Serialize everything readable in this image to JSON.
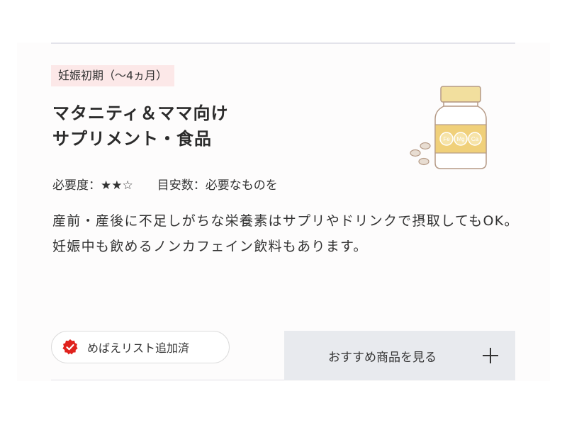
{
  "card": {
    "tag": "妊娠初期（〜4ヵ月）",
    "title_line1": "マタニティ＆ママ向け",
    "title_line2": "サプリメント・食品",
    "necessity_label": "必要度：",
    "necessity_rating": "★★☆",
    "guideline": "目安数：必要なものを",
    "description": "産前・産後に不足しがちな栄養素はサプリやドリンクで摂取してもOK。妊娠中も飲めるノンカフェイン飲料もあります。",
    "bottle_labels": [
      "Fe",
      "Mg",
      "Ca"
    ]
  },
  "actions": {
    "added_label": "めばえリスト追加済",
    "recommend_label": "おすすめ商品を見る"
  },
  "colors": {
    "tag_bg": "#fce8e8",
    "badge_red": "#e0221d",
    "button_bg": "#e8eaee",
    "bottle_cap": "#f2df9e",
    "bottle_label": "#f0d07a"
  },
  "icons": {
    "badge": "check-badge-icon",
    "plus": "plus-icon",
    "bottle": "supplement-bottle-icon"
  }
}
